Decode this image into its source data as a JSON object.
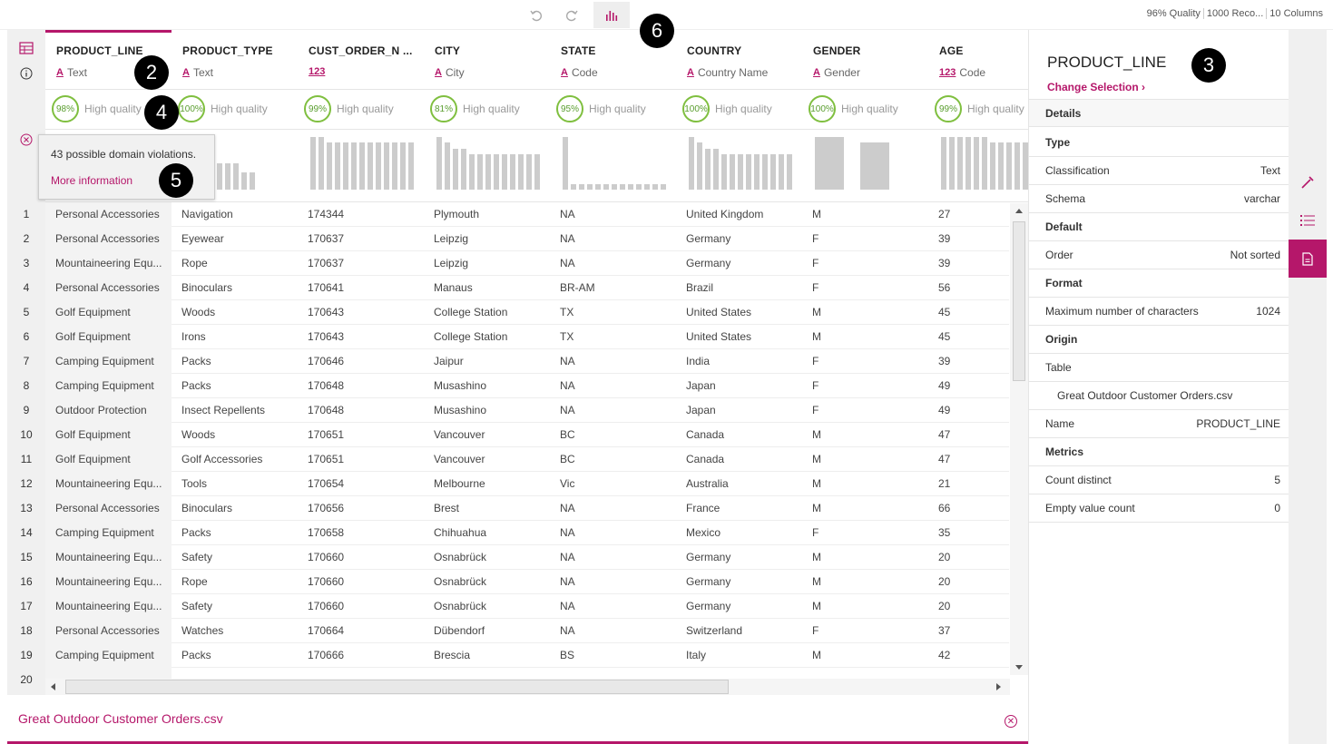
{
  "toolbar": {
    "undo_icon": "undo-icon",
    "redo_icon": "redo-icon",
    "chart_icon": "bar-chart-icon",
    "stats": [
      "96% Quality",
      "1000 Reco...",
      "10 Columns"
    ]
  },
  "callouts": [
    "2",
    "3",
    "4",
    "5",
    "6"
  ],
  "columns": [
    {
      "name": "PRODUCT_LINE",
      "type_icon": "A",
      "type": "Text",
      "quality_pct": "98%",
      "quality": "High quality"
    },
    {
      "name": "PRODUCT_TYPE",
      "type_icon": "A",
      "type": "Text",
      "quality_pct": "100%",
      "quality": "High quality"
    },
    {
      "name": "CUST_ORDER_N ...",
      "type_icon": "123",
      "type": "",
      "quality_pct": "99%",
      "quality": "High quality"
    },
    {
      "name": "CITY",
      "type_icon": "A",
      "type": "City",
      "quality_pct": "81%",
      "quality": "High quality"
    },
    {
      "name": "STATE",
      "type_icon": "A",
      "type": "Code",
      "quality_pct": "95%",
      "quality": "High quality"
    },
    {
      "name": "COUNTRY",
      "type_icon": "A",
      "type": "Country Name",
      "quality_pct": "100%",
      "quality": "High quality"
    },
    {
      "name": "GENDER",
      "type_icon": "A",
      "type": "Gender",
      "quality_pct": "100%",
      "quality": "High quality"
    },
    {
      "name": "AGE",
      "type_icon": "123",
      "type": "Code",
      "quality_pct": "99%",
      "quality": "High quality"
    }
  ],
  "histograms": [
    [
      5
    ],
    [
      6,
      4,
      3,
      3,
      3,
      3,
      3,
      2,
      2
    ],
    [
      9,
      9,
      8,
      8,
      8,
      8,
      8,
      8,
      8,
      8,
      8,
      8,
      8
    ],
    [
      9,
      8,
      7,
      7,
      6,
      6,
      6,
      6,
      6,
      6,
      6,
      6,
      6
    ],
    [
      9,
      1,
      1,
      1,
      1,
      1,
      1,
      1,
      1,
      1,
      1,
      1,
      1
    ],
    [
      9,
      8,
      7,
      7,
      6,
      6,
      6,
      6,
      6,
      6,
      6,
      6,
      6
    ],
    [
      10,
      9
    ],
    [
      10,
      10,
      10,
      10,
      10,
      10,
      9,
      9,
      9,
      9,
      9,
      9,
      9
    ]
  ],
  "rows": [
    [
      "1",
      "Personal Accessories",
      "Navigation",
      "174344",
      "Plymouth",
      "NA",
      "United Kingdom",
      "M",
      "27"
    ],
    [
      "2",
      "Personal Accessories",
      "Eyewear",
      "170637",
      "Leipzig",
      "NA",
      "Germany",
      "F",
      "39"
    ],
    [
      "3",
      "Mountaineering Equ...",
      "Rope",
      "170637",
      "Leipzig",
      "NA",
      "Germany",
      "F",
      "39"
    ],
    [
      "4",
      "Personal Accessories",
      "Binoculars",
      "170641",
      "Manaus",
      "BR-AM",
      "Brazil",
      "F",
      "56"
    ],
    [
      "5",
      "Golf Equipment",
      "Woods",
      "170643",
      "College Station",
      "TX",
      "United States",
      "M",
      "45"
    ],
    [
      "6",
      "Golf Equipment",
      "Irons",
      "170643",
      "College Station",
      "TX",
      "United States",
      "M",
      "45"
    ],
    [
      "7",
      "Camping Equipment",
      "Packs",
      "170646",
      "Jaipur",
      "NA",
      "India",
      "F",
      "39"
    ],
    [
      "8",
      "Camping Equipment",
      "Packs",
      "170648",
      "Musashino",
      "NA",
      "Japan",
      "F",
      "49"
    ],
    [
      "9",
      "Outdoor Protection",
      "Insect Repellents",
      "170648",
      "Musashino",
      "NA",
      "Japan",
      "F",
      "49"
    ],
    [
      "10",
      "Golf Equipment",
      "Woods",
      "170651",
      "Vancouver",
      "BC",
      "Canada",
      "M",
      "47"
    ],
    [
      "11",
      "Golf Equipment",
      "Golf Accessories",
      "170651",
      "Vancouver",
      "BC",
      "Canada",
      "M",
      "47"
    ],
    [
      "12",
      "Mountaineering Equ...",
      "Tools",
      "170654",
      "Melbourne",
      "Vic",
      "Australia",
      "M",
      "21"
    ],
    [
      "13",
      "Personal Accessories",
      "Binoculars",
      "170656",
      "Brest",
      "NA",
      "France",
      "M",
      "66"
    ],
    [
      "14",
      "Camping Equipment",
      "Packs",
      "170658",
      "Chihuahua",
      "NA",
      "Mexico",
      "F",
      "35"
    ],
    [
      "15",
      "Mountaineering Equ...",
      "Safety",
      "170660",
      "Osnabrück",
      "NA",
      "Germany",
      "M",
      "20"
    ],
    [
      "16",
      "Mountaineering Equ...",
      "Rope",
      "170660",
      "Osnabrück",
      "NA",
      "Germany",
      "M",
      "20"
    ],
    [
      "17",
      "Mountaineering Equ...",
      "Safety",
      "170660",
      "Osnabrück",
      "NA",
      "Germany",
      "M",
      "20"
    ],
    [
      "18",
      "Personal Accessories",
      "Watches",
      "170664",
      "Dübendorf",
      "NA",
      "Switzerland",
      "F",
      "37"
    ],
    [
      "19",
      "Camping Equipment",
      "Packs",
      "170666",
      "Brescia",
      "BS",
      "Italy",
      "M",
      "42"
    ],
    [
      "20",
      "",
      "",
      "",
      "",
      "",
      "",
      "",
      ""
    ]
  ],
  "tooltip": {
    "message": "43 possible domain violations.",
    "link": "More information"
  },
  "footer": {
    "filename": "Great Outdoor Customer Orders.csv"
  },
  "panel": {
    "title": "PRODUCT_LINE",
    "change": "Change Selection",
    "tab": "Details",
    "items": [
      {
        "kind": "section",
        "label": "Type",
        "value": ""
      },
      {
        "kind": "row",
        "label": "Classification",
        "value": "Text"
      },
      {
        "kind": "row",
        "label": "Schema",
        "value": "varchar"
      },
      {
        "kind": "section",
        "label": "Default",
        "value": ""
      },
      {
        "kind": "row",
        "label": "Order",
        "value": "Not sorted"
      },
      {
        "kind": "section",
        "label": "Format",
        "value": ""
      },
      {
        "kind": "row",
        "label": "Maximum number of characters",
        "value": "1024"
      },
      {
        "kind": "section",
        "label": "Origin",
        "value": ""
      },
      {
        "kind": "row",
        "label": "Table",
        "value": ""
      },
      {
        "kind": "row",
        "label": "   Great Outdoor Customer Orders.csv",
        "value": ""
      },
      {
        "kind": "row",
        "label": "Name",
        "value": "PRODUCT_LINE"
      },
      {
        "kind": "section",
        "label": "Metrics",
        "value": ""
      },
      {
        "kind": "row",
        "label": "Count distinct",
        "value": "5"
      },
      {
        "kind": "row",
        "label": "Empty value count",
        "value": "0"
      }
    ]
  },
  "colors": {
    "accent": "#b5176a",
    "quality_ring": "#7fbf3f"
  }
}
